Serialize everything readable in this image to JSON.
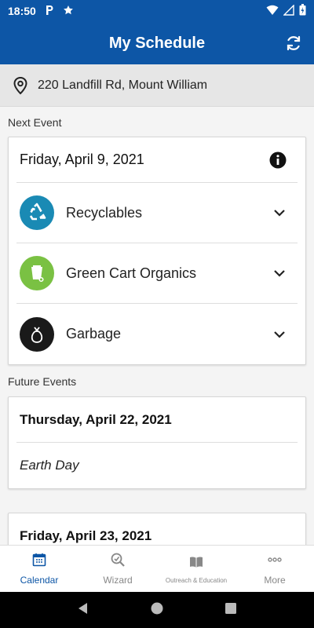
{
  "status_bar": {
    "time": "18:50",
    "icons": [
      "parking-icon",
      "star-icon",
      "wifi-icon",
      "signal-icon",
      "battery-icon"
    ]
  },
  "app_bar": {
    "title": "My Schedule",
    "refresh_icon": "refresh-icon"
  },
  "address": {
    "text": "220 Landfill Rd, Mount William",
    "icon": "location-pin-icon"
  },
  "next_event": {
    "section_label": "Next Event",
    "date": "Friday, April 9, 2021",
    "items": [
      {
        "label": "Recyclables",
        "color": "#1a8ab4",
        "icon": "recycle-icon"
      },
      {
        "label": "Green Cart Organics",
        "color": "#7ac143",
        "icon": "green-cart-icon"
      },
      {
        "label": "Garbage",
        "color": "#1a1a1a",
        "icon": "garbage-bag-icon"
      }
    ]
  },
  "future_events": {
    "section_label": "Future Events",
    "cards": [
      {
        "date": "Thursday, April 22, 2021",
        "event": "Earth Day"
      },
      {
        "date": "Friday, April 23, 2021"
      }
    ]
  },
  "bottom_nav": {
    "items": [
      {
        "label": "Calendar",
        "icon": "calendar-icon",
        "active": true
      },
      {
        "label": "Wizard",
        "icon": "wizard-icon",
        "active": false
      },
      {
        "label": "Outreach & Education",
        "icon": "book-icon",
        "active": false
      },
      {
        "label": "More",
        "icon": "more-icon",
        "active": false
      }
    ]
  },
  "colors": {
    "primary": "#0d56a6",
    "recyclables": "#1a8ab4",
    "organics": "#7ac143",
    "garbage": "#1a1a1a"
  }
}
